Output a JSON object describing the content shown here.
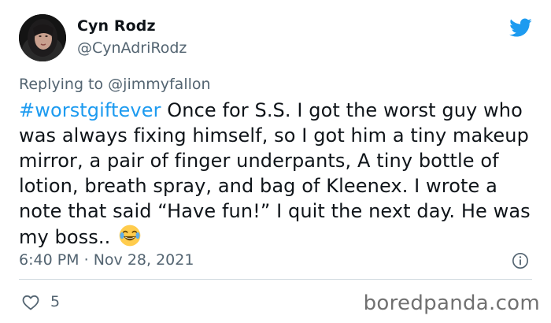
{
  "user": {
    "display_name": "Cyn Rodz",
    "handle": "@CynAdriRodz"
  },
  "reply": {
    "prefix": "Replying to",
    "mention": "@jimmyfallon"
  },
  "tweet": {
    "hashtag": "#worstgiftever",
    "text": " Once for S.S. I got the worst guy who was always fixing himself, so I got him a tiny makeup mirror, a pair of finger underpants, A tiny bottle of lotion, breath spray, and bag of Kleenex. I wrote a note that said “Have fun!” I quit the next day. He was my boss.. "
  },
  "meta": {
    "time": "6:40 PM",
    "separator": "·",
    "date": "Nov 28, 2021"
  },
  "engagement": {
    "likes": "5"
  },
  "watermark": "boredpanda.com",
  "colors": {
    "accent": "#1d9bf0",
    "secondary_text": "#536471",
    "primary_text": "#0f1419"
  },
  "icons": [
    "twitter-bird-icon",
    "info-icon",
    "heart-icon",
    "laughing-emoji-icon"
  ]
}
